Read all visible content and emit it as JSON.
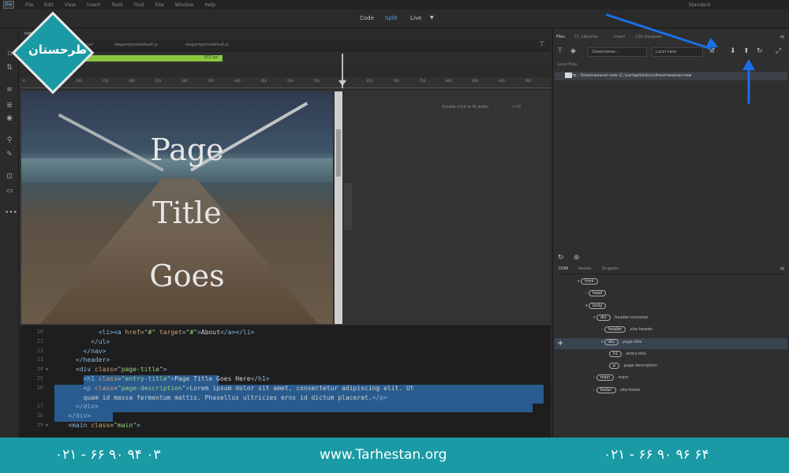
{
  "app": {
    "logo": "Dw",
    "menu": [
      "File",
      "Edit",
      "View",
      "Insert",
      "Tools",
      "Find",
      "Site",
      "Window",
      "Help"
    ],
    "workspace": "Standard"
  },
  "view_switcher": {
    "code": "Code",
    "split": "Split",
    "live": "Live"
  },
  "document": {
    "doc_tab": "index.h",
    "related_files": [
      "style.css*",
      "elegantpointdefault.js",
      "elegantpointdefault.js"
    ],
    "media_query_label": "972 px",
    "ruler_ticks": [
      "0",
      "50",
      "100",
      "150",
      "200",
      "250",
      "300",
      "350",
      "400",
      "450",
      "500",
      "550",
      "600",
      "650",
      "700",
      "750",
      "800",
      "850",
      "900",
      "950"
    ],
    "hero_title_lines": [
      "Page",
      "Title",
      "Goes"
    ],
    "fit_hint": "Double click to fit width"
  },
  "code": {
    "lines": [
      {
        "n": "20",
        "fold": "",
        "html": "<span class='txt'>            </span><span class='tag'>&lt;li&gt;&lt;a</span> <span class='att'>href</span>=<span class='str'>\"#\"</span> <span class='att'>target</span>=<span class='str'>\"#\"</span><span class='tag'>&gt;</span><span class='txt'>About</span><span class='tag'>&lt;/a&gt;&lt;/li&gt;</span>"
      },
      {
        "n": "21",
        "fold": "",
        "html": "          <span class='tag'>&lt;/ul&gt;</span>"
      },
      {
        "n": "22",
        "fold": "",
        "html": "        <span class='tag'>&lt;/nav&gt;</span>"
      },
      {
        "n": "23",
        "fold": "",
        "html": "      <span class='tag'>&lt;/header&gt;</span>"
      },
      {
        "n": "24",
        "fold": "▼",
        "html": "      <span class='tag'>&lt;div</span> <span class='att'>class</span>=<span class='str'>\"page-title\"</span><span class='tag'>&gt;</span>"
      },
      {
        "n": "25",
        "fold": "",
        "html": "        <span class='tag'>&lt;h1</span> <span class='att'>class</span>=<span class='str'>\"entry-title\"</span><span class='tag'>&gt;</span><span class='txt'>Page Title Goes Here</span><span class='tag'>&lt;/h1&gt;</span>"
      },
      {
        "n": "26",
        "fold": "",
        "html": "        <span class='tag'>&lt;p</span> <span class='att'>class</span>=<span class='str'>\"page-description\"</span><span class='tag'>&gt;</span><span class='txt'>Lorem ipsum dolor sit amet, consectetur adipiscing elit. Ut</span>"
      },
      {
        "n": "",
        "fold": "",
        "html": "<span class='txt'>        quam id massa fermentum mattis. Phasellus ultricies eros id dictum placerat.</span><span class='tag'>&lt;/p&gt;</span>"
      },
      {
        "n": "27",
        "fold": "",
        "html": "      <span class='tag'>&lt;/div&gt;</span>"
      },
      {
        "n": "28",
        "fold": "",
        "html": "    <span class='tag'>&lt;/div&gt;</span>"
      },
      {
        "n": "29",
        "fold": "▼",
        "html": "    <span class='tag'>&lt;main</span> <span class='att'>class</span>=<span class='str'>\"main\"</span><span class='tag'>&gt;</span>"
      }
    ]
  },
  "files_panel": {
    "tabs": [
      "Files",
      "CC Libraries",
      "Insert",
      "CSS Designer"
    ],
    "site_select": "Dreamweav...",
    "view_select": "Local view",
    "local_files_label": "Local Files",
    "site_row": "Site - Dreamweaver-new (C:\\xampp\\htdocs\\dreamweaver-new"
  },
  "dom_panel": {
    "tabs": [
      "DOM",
      "Assets",
      "Snippets"
    ],
    "nodes": [
      {
        "tag": "html",
        "label": "",
        "depth": 0
      },
      {
        "tag": "head",
        "label": "",
        "depth": 1
      },
      {
        "tag": "body",
        "label": "",
        "depth": 1
      },
      {
        "tag": "div",
        "label": ".header-container",
        "depth": 2
      },
      {
        "tag": "header",
        "label": ".site-header",
        "depth": 3
      },
      {
        "tag": "div",
        "label": ".page-title",
        "depth": 3
      },
      {
        "tag": "h1",
        "label": ".entry-title",
        "depth": 4
      },
      {
        "tag": "p",
        "label": ".page-description",
        "depth": 4
      },
      {
        "tag": "main",
        "label": ".main",
        "depth": 2
      },
      {
        "tag": "footer",
        "label": ".site-footer",
        "depth": 2
      }
    ]
  },
  "watermark": {
    "logo_text": "طرحستان"
  },
  "footer": {
    "phone_left": "۰۲۱ - ۶۶ ۹۰ ۹۴ ۰۳",
    "website": "www.Tarhestan.org",
    "phone_right": "۰۲۱ - ۶۶ ۹۰ ۹۶ ۶۴"
  },
  "colors": {
    "accent": "#1a9aa5",
    "arrow": "#1a6fe8",
    "media_query": "#8dc63f"
  }
}
